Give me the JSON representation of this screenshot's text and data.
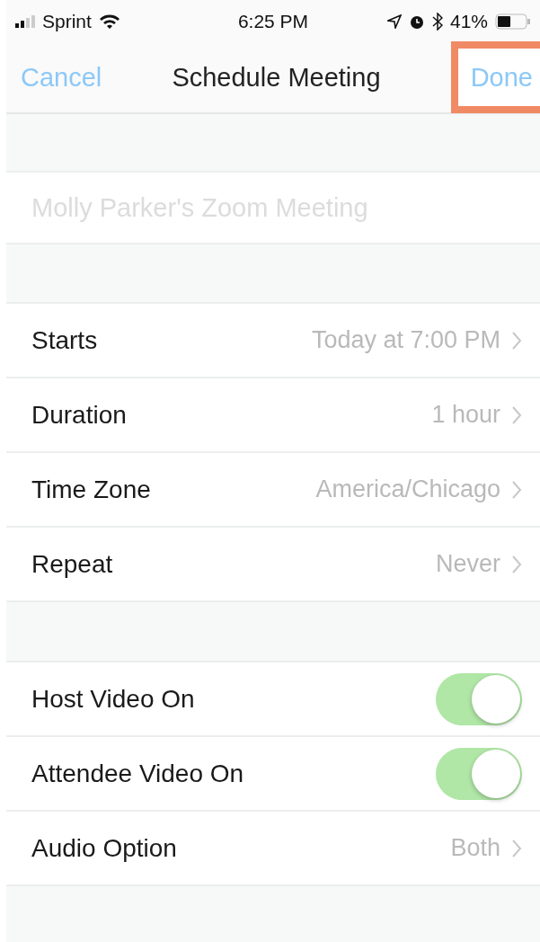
{
  "status_bar": {
    "carrier": "Sprint",
    "time": "6:25 PM",
    "battery": "41%"
  },
  "nav": {
    "cancel": "Cancel",
    "title": "Schedule Meeting",
    "done": {
      "label": "Done",
      "highlighted": true
    }
  },
  "topic": {
    "placeholder": "Molly Parker's Zoom Meeting"
  },
  "groups": [
    {
      "rows": [
        {
          "kind": "detail",
          "label": "Starts",
          "value": "Today at 7:00 PM"
        },
        {
          "kind": "detail",
          "label": "Duration",
          "value": "1 hour"
        },
        {
          "kind": "detail",
          "label": "Time Zone",
          "value": "America/Chicago"
        },
        {
          "kind": "detail",
          "label": "Repeat",
          "value": "Never"
        }
      ]
    },
    {
      "rows": [
        {
          "kind": "toggle",
          "label": "Host Video On",
          "on": true
        },
        {
          "kind": "toggle",
          "label": "Attendee Video On",
          "on": true
        },
        {
          "kind": "detail",
          "label": "Audio Option",
          "value": "Both"
        }
      ]
    }
  ]
}
